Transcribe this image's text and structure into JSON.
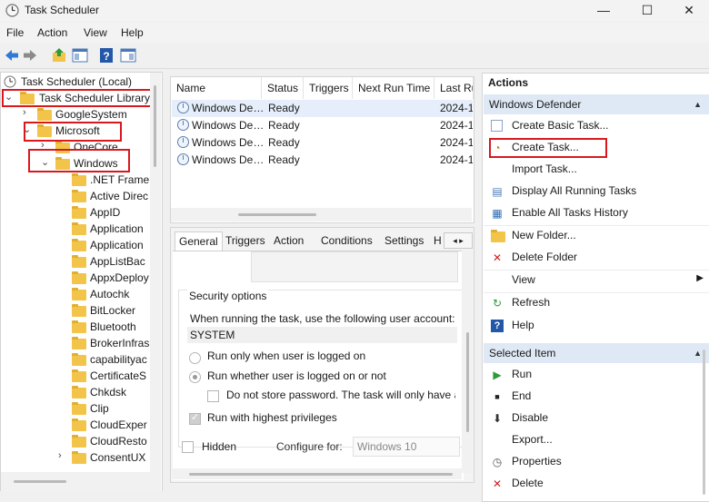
{
  "window": {
    "title": "Task Scheduler",
    "controls": {
      "minimize": "—",
      "maximize": "☐",
      "close": "✕"
    }
  },
  "menu": {
    "items": [
      "File",
      "Action",
      "View",
      "Help"
    ]
  },
  "tree": {
    "root": "Task Scheduler (Local)",
    "library": "Task Scheduler Library",
    "google": "GoogleSystem",
    "microsoft": "Microsoft",
    "onecore": "OneCore",
    "windows": "Windows",
    "folders": [
      ".NET Frame",
      "Active Direc",
      "AppID",
      "Application",
      "Application",
      "AppListBac",
      "AppxDeploy",
      "Autochk",
      "BitLocker",
      "Bluetooth",
      "BrokerInfras",
      "capabilityac",
      "CertificateS",
      "Chkdsk",
      "Clip",
      "CloudExper",
      "CloudResto",
      "ConsentUX"
    ]
  },
  "tasks": {
    "columns": [
      "Name",
      "Status",
      "Triggers",
      "Next Run Time",
      "Last Ru"
    ],
    "rows": [
      {
        "name": "Windows De…",
        "status": "Ready",
        "last": "2024-1"
      },
      {
        "name": "Windows De…",
        "status": "Ready",
        "last": "2024-1"
      },
      {
        "name": "Windows De…",
        "status": "Ready",
        "last": "2024-1"
      },
      {
        "name": "Windows De…",
        "status": "Ready",
        "last": "2024-1"
      }
    ]
  },
  "details": {
    "tabs": [
      "General",
      "Triggers",
      "Action",
      "Conditions",
      "Settings",
      "H"
    ],
    "security_header": "Security options",
    "user_label": "When running the task, use the following user account:",
    "user_value": "SYSTEM",
    "opt_logged_on": "Run only when user is logged on",
    "opt_whether": "Run whether user is logged on or not",
    "opt_no_store": "Do not store password.  The task will only have a",
    "opt_highest": "Run with highest privileges",
    "hidden_label": "Hidden",
    "configure_label": "Configure for:",
    "configure_value": "Windows 10"
  },
  "actions": {
    "header": "Actions",
    "section1": "Windows Defender",
    "items1": [
      "Create Basic Task...",
      "Create Task...",
      "Import Task...",
      "Display All Running Tasks",
      "Enable All Tasks History",
      "New Folder...",
      "Delete Folder",
      "View",
      "Refresh",
      "Help"
    ],
    "section2": "Selected Item",
    "items2": [
      "Run",
      "End",
      "Disable",
      "Export...",
      "Properties",
      "Delete"
    ]
  },
  "colors": {
    "highlight_red": "#d9181c",
    "section_blue": "#dfe9f5",
    "folder_yellow": "#f2c54a"
  }
}
